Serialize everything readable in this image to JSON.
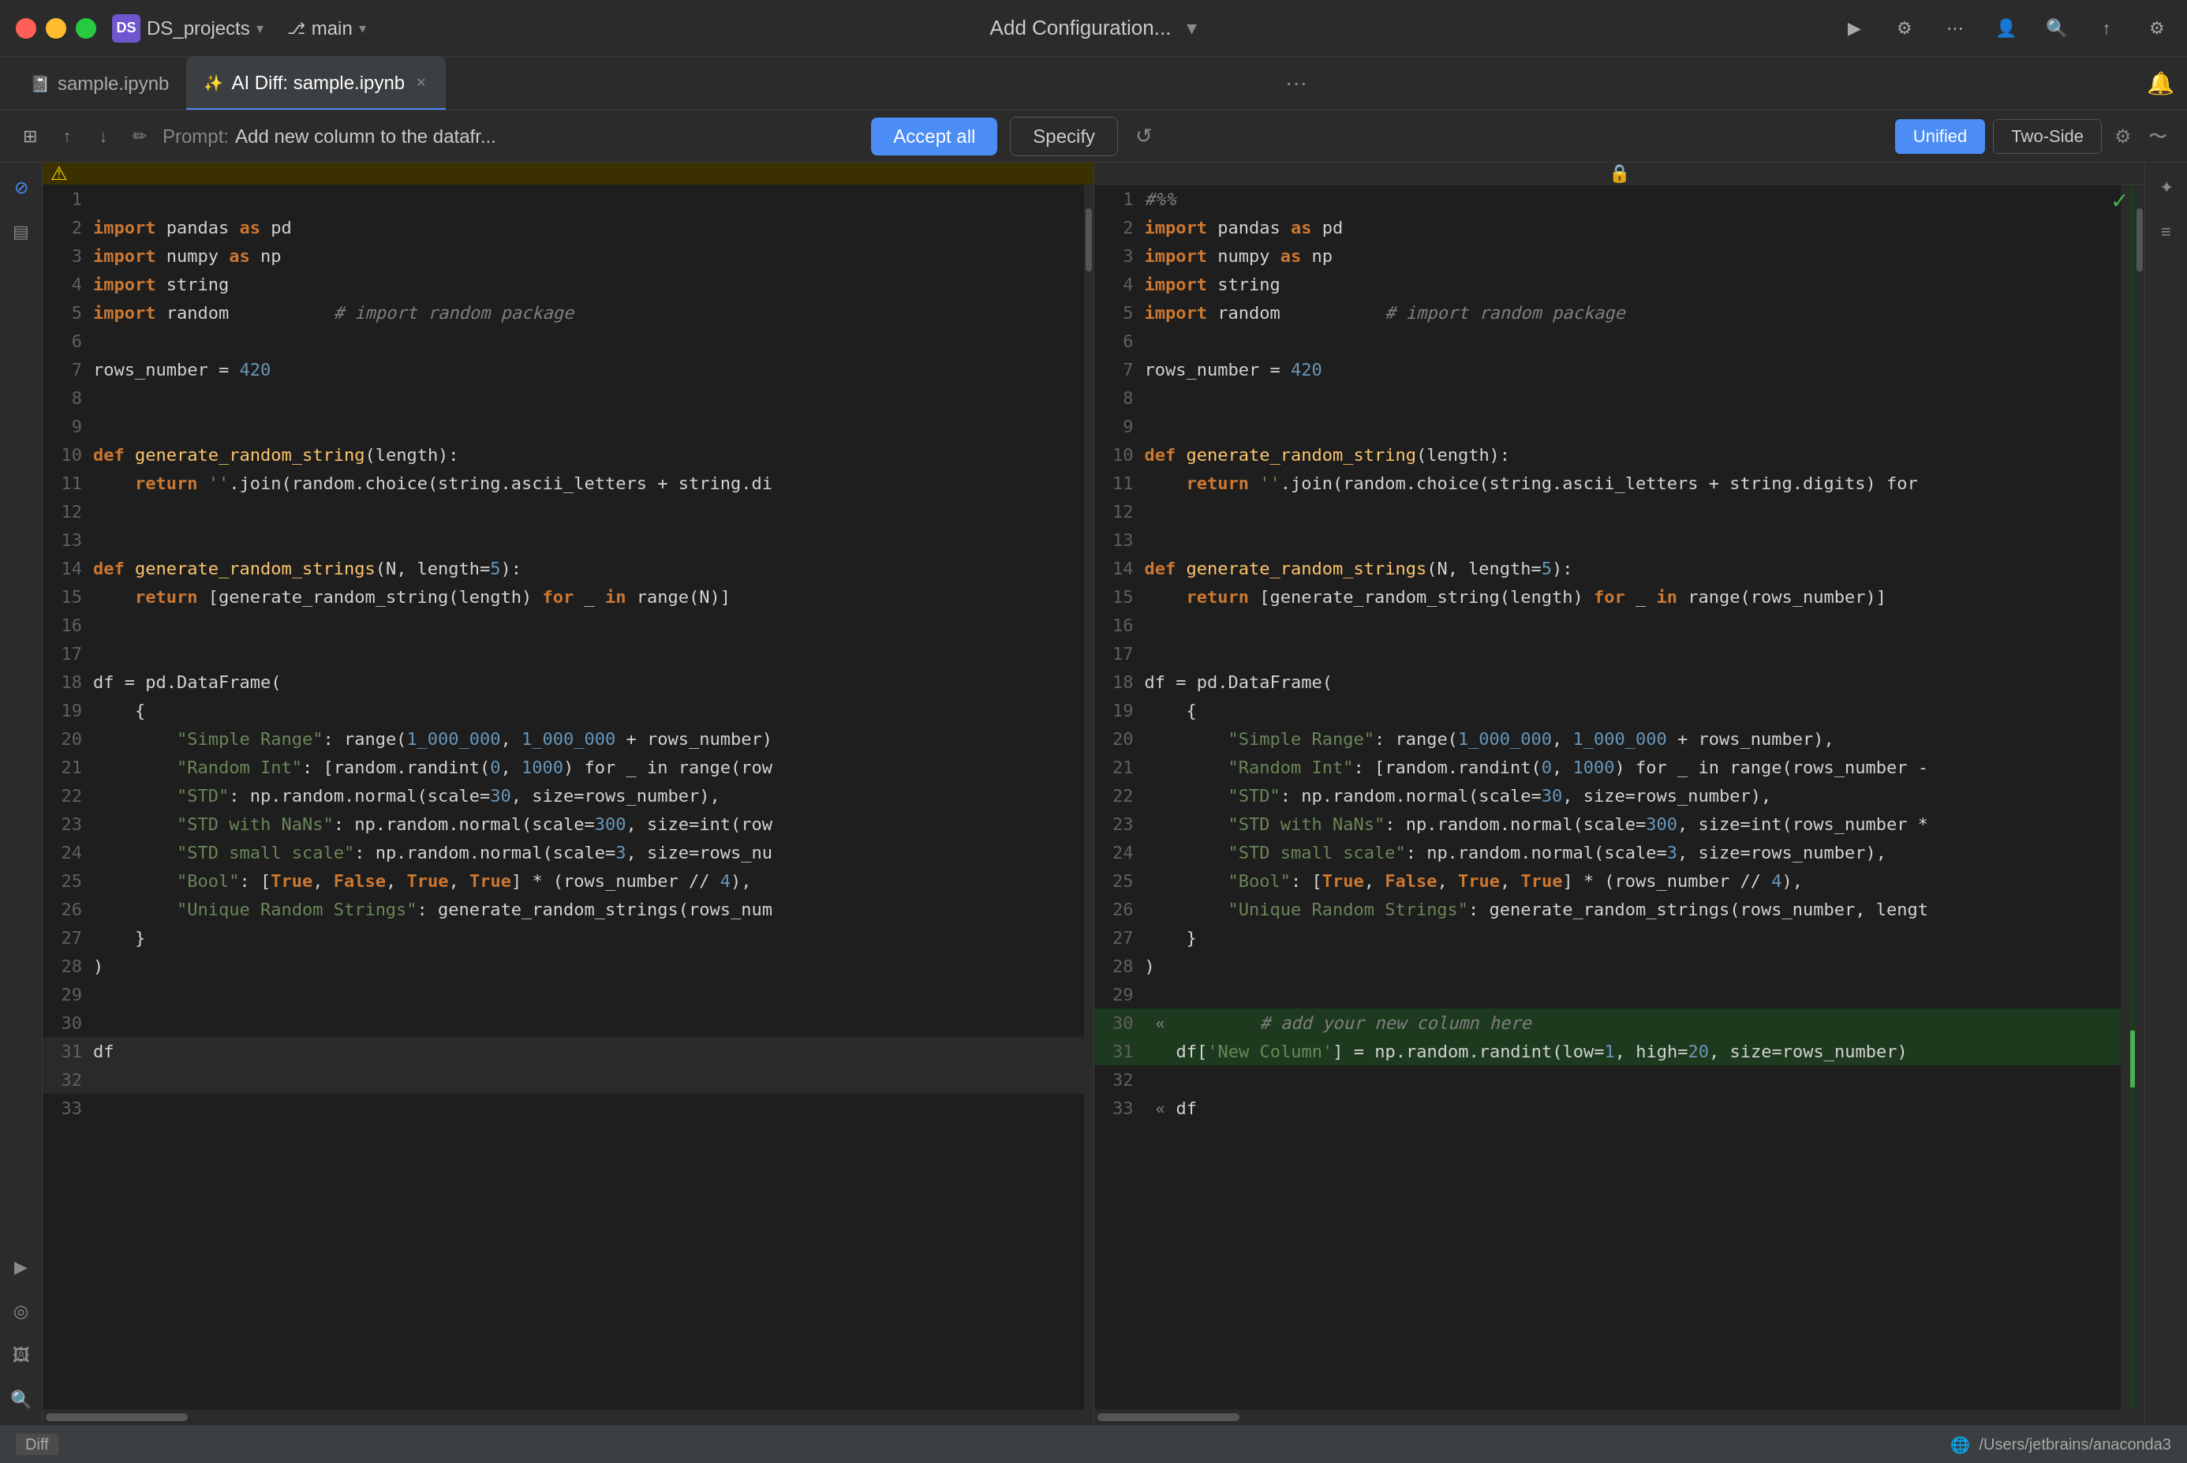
{
  "titlebar": {
    "project": "DS_projects",
    "branch": "main",
    "title": "Add Configuration...",
    "avatar_initials": "DS"
  },
  "tabs": [
    {
      "id": "sample-ipynb",
      "label": "sample.ipynb",
      "active": false
    },
    {
      "id": "ai-diff",
      "label": "AI Diff: sample.ipynb",
      "active": true
    }
  ],
  "toolbar": {
    "prompt_prefix": "Prompt:",
    "prompt_text": "Add new column to the datafr...",
    "accept_all": "Accept all",
    "specify": "Specify",
    "view_unified": "Unified",
    "view_two_side": "Two-Side"
  },
  "left_panel": {
    "lines": [
      {
        "ln": "1",
        "code": ""
      },
      {
        "ln": "2",
        "code": "import pandas as pd"
      },
      {
        "ln": "3",
        "code": "import numpy as np"
      },
      {
        "ln": "4",
        "code": "import string"
      },
      {
        "ln": "5",
        "code": "import random           # import random package"
      },
      {
        "ln": "6",
        "code": ""
      },
      {
        "ln": "7",
        "code": "rows_number = 420"
      },
      {
        "ln": "8",
        "code": ""
      },
      {
        "ln": "9",
        "code": ""
      },
      {
        "ln": "10",
        "code": "def generate_random_string(length):"
      },
      {
        "ln": "11",
        "code": "    return ''.join(random.choice(string.ascii_letters + string.di"
      },
      {
        "ln": "12",
        "code": ""
      },
      {
        "ln": "13",
        "code": ""
      },
      {
        "ln": "14",
        "code": "def generate_random_strings(N, length=5):"
      },
      {
        "ln": "15",
        "code": "    return [generate_random_string(length) for _ in range(N)]"
      },
      {
        "ln": "16",
        "code": ""
      },
      {
        "ln": "17",
        "code": ""
      },
      {
        "ln": "18",
        "code": "df = pd.DataFrame("
      },
      {
        "ln": "19",
        "code": "    {"
      },
      {
        "ln": "20",
        "code": "        \"Simple Range\": range(1_000_000, 1_000_000 + rows_number)"
      },
      {
        "ln": "21",
        "code": "        \"Random Int\": [random.randint(0, 1000) for _ in range(row"
      },
      {
        "ln": "22",
        "code": "        \"STD\": np.random.normal(scale=30, size=rows_number),"
      },
      {
        "ln": "23",
        "code": "        \"STD with NaNs\": np.random.normal(scale=300, size=int(row"
      },
      {
        "ln": "24",
        "code": "        \"STD small scale\": np.random.normal(scale=3, size=rows_nu"
      },
      {
        "ln": "25",
        "code": "        \"Bool\": [True, False, True, True] * (rows_number // 4),"
      },
      {
        "ln": "26",
        "code": "        \"Unique Random Strings\": generate_random_strings(rows_num"
      },
      {
        "ln": "27",
        "code": "    }"
      },
      {
        "ln": "28",
        "code": ")"
      },
      {
        "ln": "29",
        "code": ""
      },
      {
        "ln": "30",
        "code": ""
      },
      {
        "ln": "31",
        "code": "df"
      },
      {
        "ln": "32",
        "code": ""
      },
      {
        "ln": "33",
        "code": ""
      }
    ]
  },
  "right_panel": {
    "lines": [
      {
        "ln": "1",
        "code": "#%%",
        "added": false
      },
      {
        "ln": "2",
        "code": "import pandas as pd",
        "added": false
      },
      {
        "ln": "3",
        "code": "import numpy as np",
        "added": false
      },
      {
        "ln": "4",
        "code": "import string",
        "added": false
      },
      {
        "ln": "5",
        "code": "import random           # import random package",
        "added": false
      },
      {
        "ln": "6",
        "code": "",
        "added": false
      },
      {
        "ln": "7",
        "code": "rows_number = 420",
        "added": false
      },
      {
        "ln": "8",
        "code": "",
        "added": false
      },
      {
        "ln": "9",
        "code": "",
        "added": false
      },
      {
        "ln": "10",
        "code": "def generate_random_string(length):",
        "added": false
      },
      {
        "ln": "11",
        "code": "    return ''.join(random.choice(string.ascii_letters + string.digits) for",
        "added": false
      },
      {
        "ln": "12",
        "code": "",
        "added": false
      },
      {
        "ln": "13",
        "code": "",
        "added": false
      },
      {
        "ln": "14",
        "code": "def generate_random_strings(N, length=5):",
        "added": false
      },
      {
        "ln": "15",
        "code": "    return [generate_random_string(length) for _ in range(rows_number)]",
        "added": false
      },
      {
        "ln": "16",
        "code": "",
        "added": false
      },
      {
        "ln": "17",
        "code": "",
        "added": false
      },
      {
        "ln": "18",
        "code": "df = pd.DataFrame(",
        "added": false
      },
      {
        "ln": "19",
        "code": "    {",
        "added": false
      },
      {
        "ln": "20",
        "code": "        \"Simple Range\": range(1_000_000, 1_000_000 + rows_number),",
        "added": false
      },
      {
        "ln": "21",
        "code": "        \"Random Int\": [random.randint(0, 1000) for _ in range(rows_number -",
        "added": false
      },
      {
        "ln": "22",
        "code": "        \"STD\": np.random.normal(scale=30, size=rows_number),",
        "added": false
      },
      {
        "ln": "23",
        "code": "        \"STD with NaNs\": np.random.normal(scale=300, size=int(rows_number *",
        "added": false
      },
      {
        "ln": "24",
        "code": "        \"STD small scale\": np.random.normal(scale=3, size=rows_number),",
        "added": false
      },
      {
        "ln": "25",
        "code": "        \"Bool\": [True, False, True, True] * (rows_number // 4),",
        "added": false
      },
      {
        "ln": "26",
        "code": "        \"Unique Random Strings\": generate_random_strings(rows_number, lengt",
        "added": false
      },
      {
        "ln": "27",
        "code": "    }",
        "added": false
      },
      {
        "ln": "28",
        "code": ")",
        "added": false
      },
      {
        "ln": "29",
        "code": "",
        "added": false
      },
      {
        "ln": "30",
        "code": "# add your new column here",
        "added": true,
        "diff_marker": "<<"
      },
      {
        "ln": "31",
        "code": "df['New Column'] = np.random.randint(low=1, high=20, size=rows_number)",
        "added": true,
        "diff_marker": ""
      },
      {
        "ln": "32",
        "code": "",
        "added": false
      },
      {
        "ln": "33",
        "code": "df",
        "added": false,
        "diff_marker": "<<"
      }
    ]
  },
  "statusbar": {
    "diff_label": "Diff",
    "path": "/Users/jetbrains/anaconda3"
  }
}
